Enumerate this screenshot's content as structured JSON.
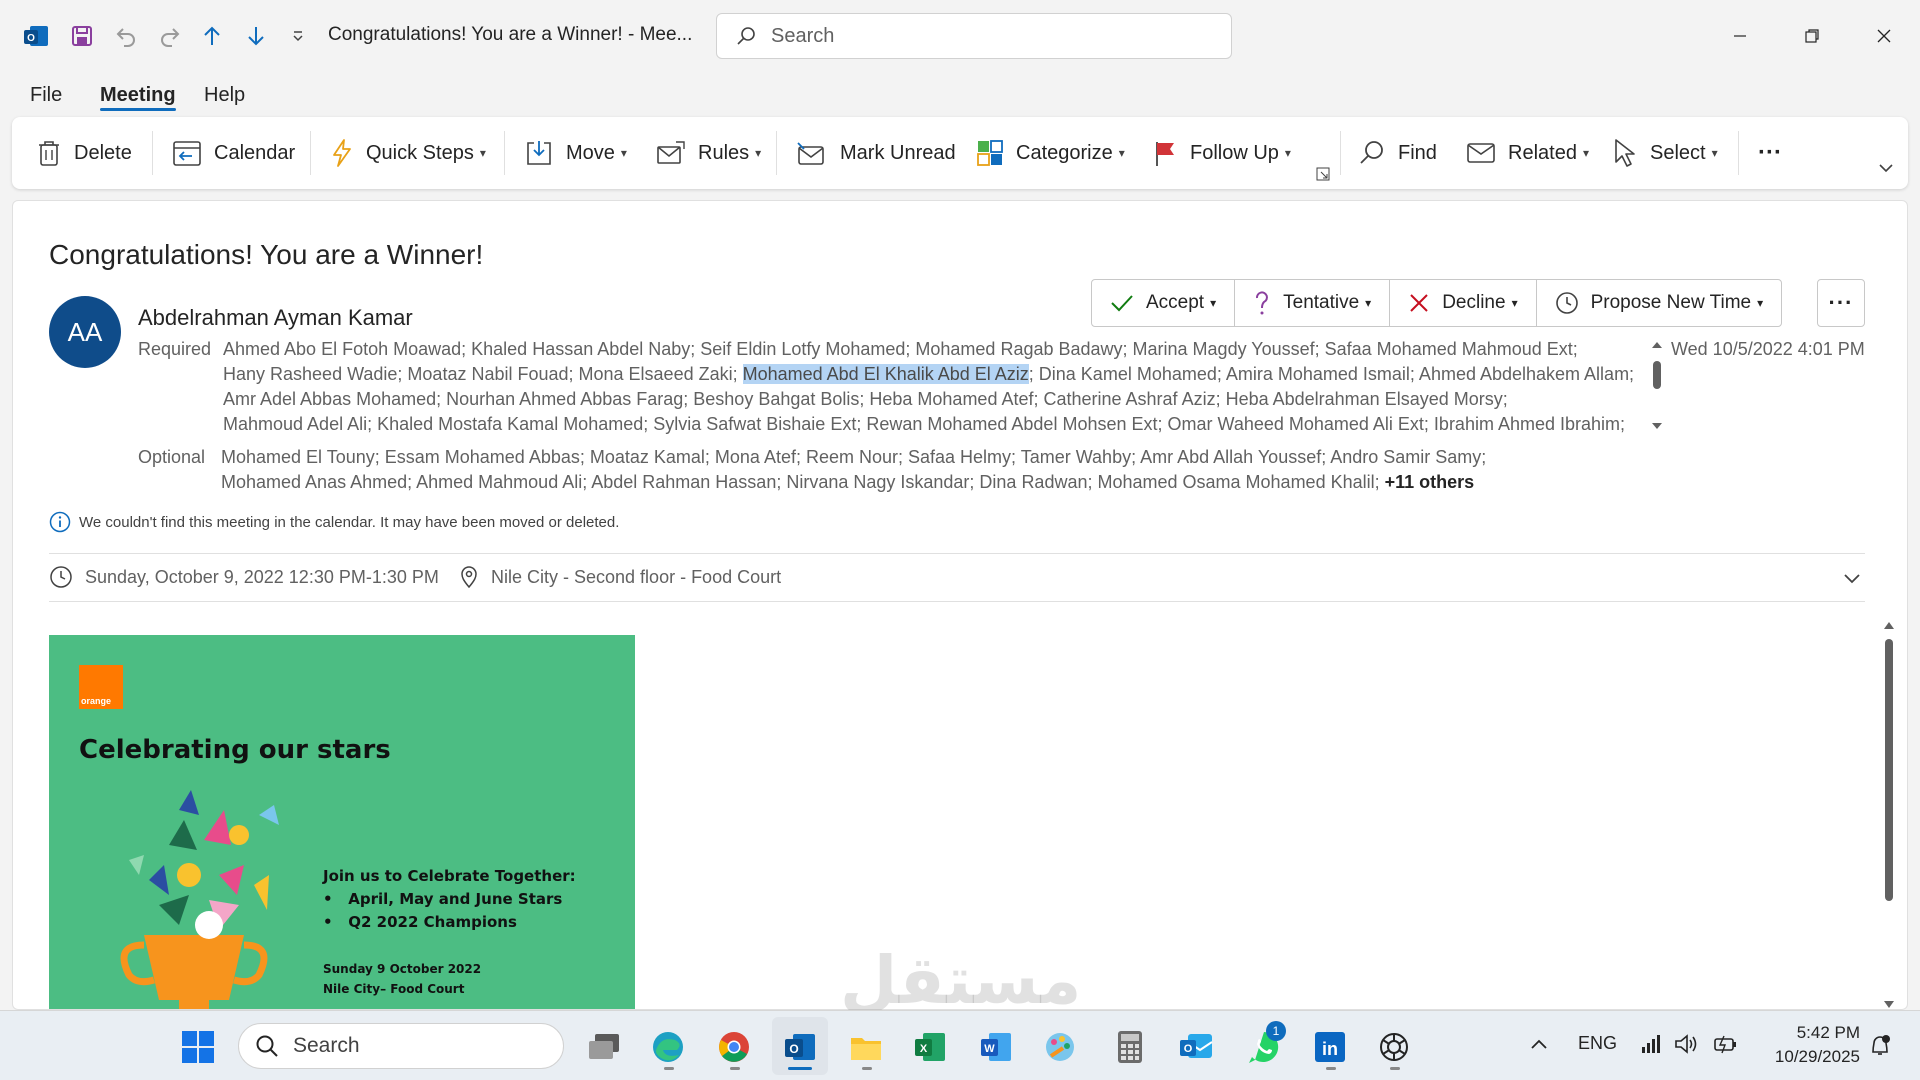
{
  "titlebar": {
    "window_title": "Congratulations! You are a Winner!  -  Mee...",
    "search_placeholder": "Search"
  },
  "menu": {
    "file": "File",
    "meeting": "Meeting",
    "help": "Help"
  },
  "ribbon": {
    "delete": "Delete",
    "calendar": "Calendar",
    "quick_steps": "Quick Steps",
    "move": "Move",
    "rules": "Rules",
    "mark_unread": "Mark Unread",
    "categorize": "Categorize",
    "follow_up": "Follow Up",
    "find": "Find",
    "related": "Related",
    "select": "Select",
    "more": "···"
  },
  "message": {
    "subject": "Congratulations! You are a Winner!",
    "avatar_initials": "AA",
    "sender": "Abdelrahman Ayman Kamar",
    "date": "Wed 10/5/2022 4:01 PM",
    "required_label": "Required",
    "required_line1": "Ahmed Abo El Fotoh Moawad; Khaled Hassan Abdel Naby; Seif Eldin Lotfy Mohamed; Mohamed Ragab Badawy; Marina Magdy Youssef; Safaa Mohamed Mahmoud Ext;",
    "required_line2_pre": "Hany Rasheed Wadie; Moataz Nabil Fouad; Mona Elsaeed Zaki; ",
    "required_line2_hl": "Mohamed Abd El Khalik Abd El Aziz",
    "required_line2_post": "; Dina Kamel Mohamed; Amira Mohamed Ismail; Ahmed Abdelhakem Allam;",
    "required_line3": "Amr Adel Abbas Mohamed; Nourhan Ahmed Abbas Farag; Beshoy Bahgat Bolis; Heba Mohamed Atef; Catherine Ashraf Aziz; Heba Abdelrahman Elsayed Morsy;",
    "required_line4": "Mahmoud Adel Ali; Khaled Mostafa Kamal Mohamed; Sylvia Safwat Bishaie Ext; Rewan Mohamed Abdel Mohsen Ext; Omar Waheed Mohamed Ali Ext; Ibrahim Ahmed Ibrahim;",
    "optional_label": "Optional",
    "optional_line1": "Mohamed El Touny; Essam Mohamed Abbas; Moataz Kamal; Mona Atef; Reem Nour; Safaa Helmy; Tamer Wahby; Amr Abd Allah Youssef; Andro Samir Samy;",
    "optional_line2": "Mohamed Anas Ahmed; Ahmed Mahmoud Ali; Abdel Rahman Hassan; Nirvana Nagy Iskandar; Dina Radwan; Mohamed Osama Mohamed Khalil; ",
    "optional_others": "+11 others",
    "info": "We couldn't find this meeting in the calendar. It may have been moved or deleted.",
    "when": "Sunday, October 9, 2022 12:30 PM-1:30 PM",
    "where": "Nile City - Second floor - Food Court"
  },
  "rsvp": {
    "accept": "Accept",
    "tentative": "Tentative",
    "decline": "Decline",
    "propose": "Propose New Time",
    "more": "···"
  },
  "banner": {
    "logo_text": "orange",
    "headline": "Celebrating our stars",
    "join": "Join us to Celebrate Together:",
    "bullet1": "April, May and June Stars",
    "bullet2": "Q2 2022 Champions",
    "event_date": "Sunday 9 October 2022",
    "event_place": "Nile City– Food Court"
  },
  "taskbar": {
    "search": "Search",
    "lang": "ENG",
    "time": "5:42 PM",
    "date": "10/29/2025",
    "whatsapp_badge": "1"
  },
  "watermark": "مستقل",
  "colors": {
    "accent": "#0f6cbd",
    "banner_green": "#4cbd83",
    "orange_brand": "#ff7900",
    "decline_red": "#c50f1f",
    "followup_red": "#d13438"
  }
}
